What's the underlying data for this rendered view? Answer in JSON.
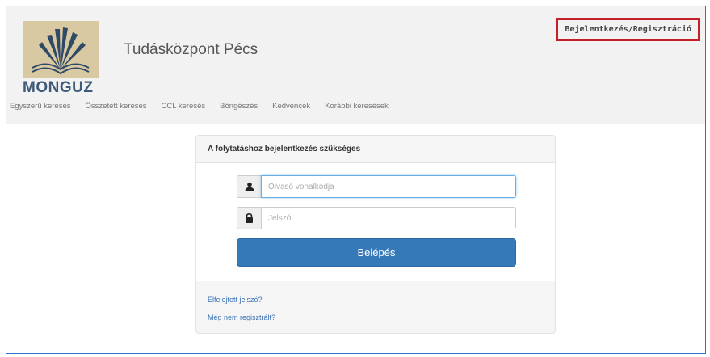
{
  "header": {
    "logo_text": "MONGUZ",
    "site_title": "Tudásközpont Pécs",
    "login_register_link": "Bejelentkezés/Regisztráció"
  },
  "nav": {
    "items": [
      "Egyszerű keresés",
      "Összetett keresés",
      "CCL keresés",
      "Böngészés",
      "Kedvencek",
      "Korábbi keresések"
    ]
  },
  "login_panel": {
    "heading": "A folytatáshoz bejelentkezés szükséges",
    "barcode_placeholder": "Olvasó vonalkódja",
    "password_placeholder": "Jelszó",
    "submit_label": "Belépés",
    "forgot_password_link": "Elfelejtett jelszó?",
    "not_registered_link": "Még nem regisztrált?"
  },
  "icons": {
    "user": "user-icon",
    "lock": "lock-icon"
  },
  "colors": {
    "primary_button": "#3579b8",
    "highlight_border": "#c4202a",
    "link": "#3a72b5"
  }
}
